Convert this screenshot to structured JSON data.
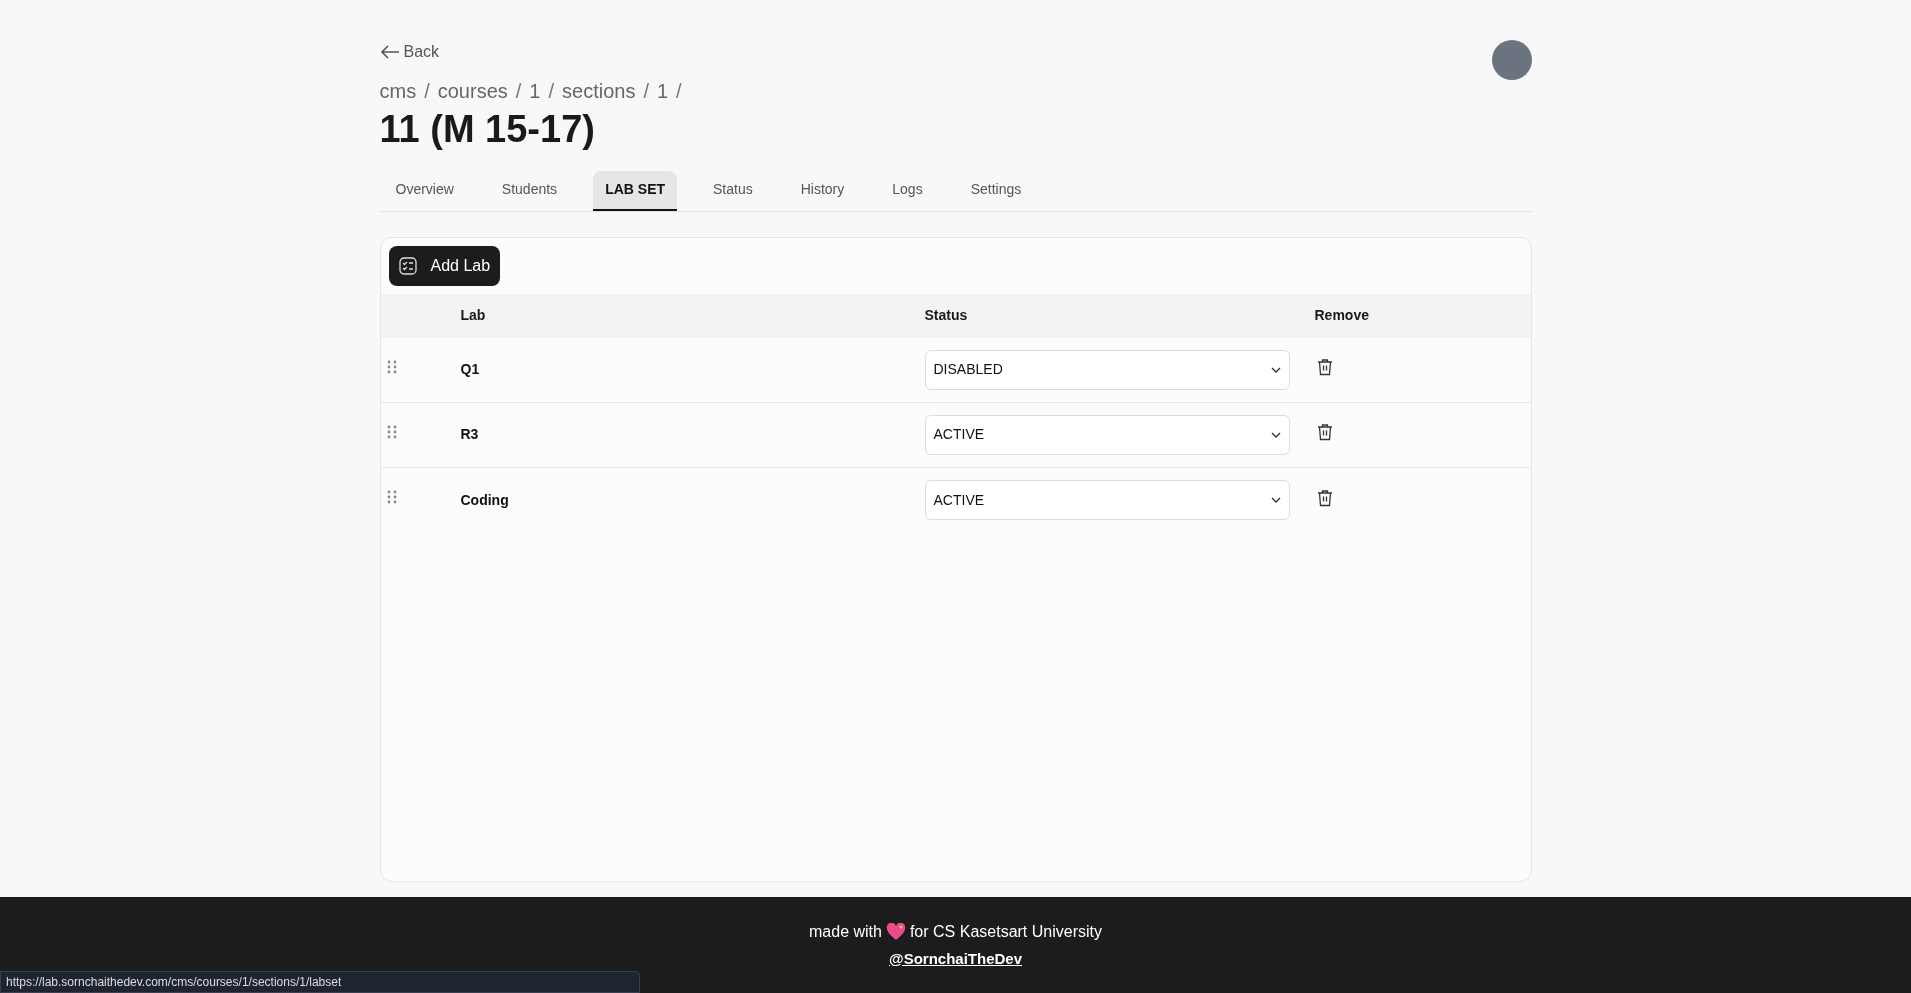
{
  "back": {
    "label": "Back"
  },
  "breadcrumb": [
    {
      "label": "cms",
      "separator": "/"
    },
    {
      "label": "courses",
      "separator": "/"
    },
    {
      "label": "1",
      "separator": "/"
    },
    {
      "label": "sections",
      "separator": "/"
    },
    {
      "label": "1",
      "separator": "/"
    }
  ],
  "title": "11 (M 15-17)",
  "tabs": [
    {
      "label": "Overview",
      "selected": false
    },
    {
      "label": "Students",
      "selected": false
    },
    {
      "label": "LAB SET",
      "selected": true
    },
    {
      "label": "Status",
      "selected": false
    },
    {
      "label": "History",
      "selected": false
    },
    {
      "label": "Logs",
      "selected": false
    },
    {
      "label": "Settings",
      "selected": false
    }
  ],
  "add_button": {
    "label": "Add Lab"
  },
  "table": {
    "columns": [
      "Lab",
      "Status",
      "Remove"
    ],
    "rows": [
      {
        "lab": "Q1",
        "status": "DISABLED"
      },
      {
        "lab": "R3",
        "status": "ACTIVE"
      },
      {
        "lab": "Coding",
        "status": "ACTIVE"
      }
    ]
  },
  "footer": {
    "before": "made with",
    "after": "for CS Kasetsart University",
    "link": "@SornchaiTheDev"
  },
  "status_bar": {
    "url": "https://lab.sornchaithedev.com/cms/courses/1/sections/1/labset"
  }
}
